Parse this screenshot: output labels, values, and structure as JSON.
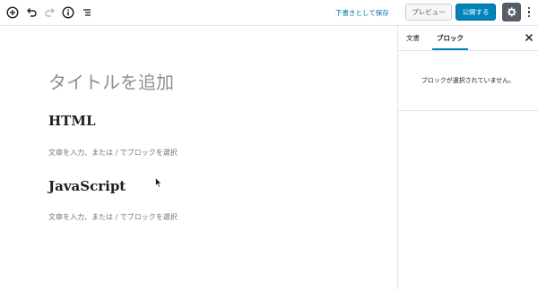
{
  "toolbar": {
    "icons": [
      "add-block-icon",
      "undo-icon",
      "redo-icon",
      "info-icon",
      "outline-icon"
    ],
    "save_draft_label": "下書きとして保存",
    "preview_label": "プレビュー",
    "publish_label": "公開する",
    "settings_icon": "gear-icon",
    "more_icon": "more-vertical-icon"
  },
  "editor": {
    "title_placeholder": "タイトルを追加",
    "blocks": [
      {
        "type": "heading",
        "text": "HTML"
      },
      {
        "type": "paragraph",
        "placeholder": "文章を入力、または / でブロックを選択"
      },
      {
        "type": "heading",
        "text": "JavaScript"
      },
      {
        "type": "paragraph",
        "placeholder": "文章を入力、または / でブロックを選択"
      }
    ]
  },
  "sidebar": {
    "tabs": [
      {
        "label": "文書",
        "active": false
      },
      {
        "label": "ブロック",
        "active": true
      }
    ],
    "empty_message": "ブロックが選択されていません。",
    "close_icon": "close-icon"
  },
  "colors": {
    "accent": "#0085ba",
    "link": "#0073aa",
    "settings_bg": "#555d66",
    "placeholder": "#8a9096"
  }
}
